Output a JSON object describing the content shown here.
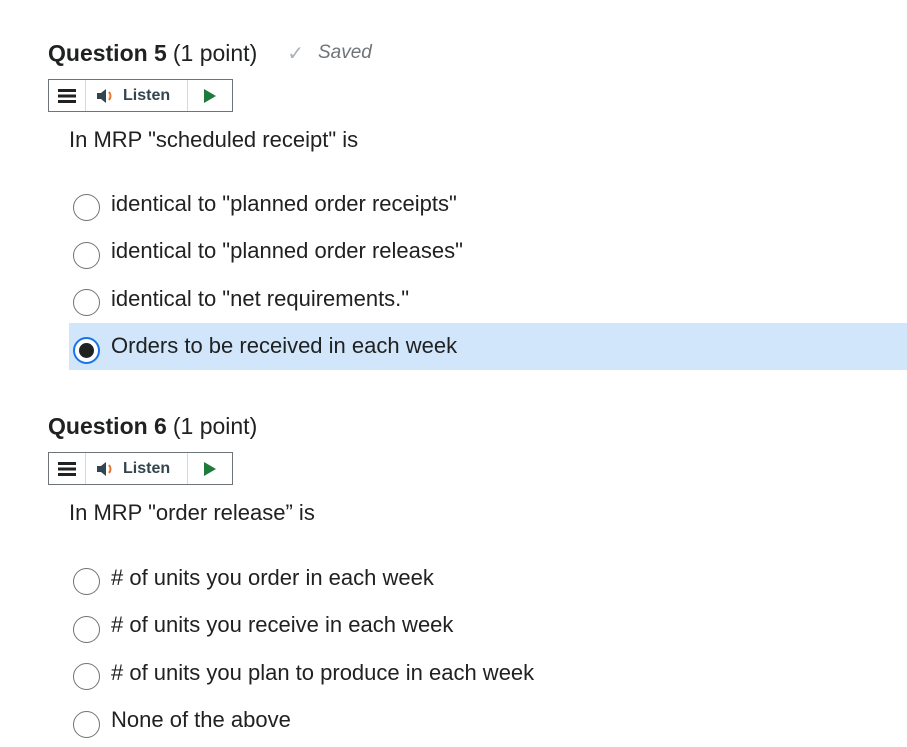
{
  "questions": [
    {
      "label": "Question 5",
      "points": "(1 point)",
      "saved": "Saved",
      "listen": "Listen",
      "text": "In MRP \"scheduled receipt\" is",
      "options": [
        {
          "label": "identical to \"planned order receipts\"",
          "selected": false
        },
        {
          "label": "identical to \"planned order releases\"",
          "selected": false
        },
        {
          "label": "identical to \"net requirements.\"",
          "selected": false
        },
        {
          "label": "Orders to be received in each week",
          "selected": true
        }
      ]
    },
    {
      "label": "Question 6",
      "points": "(1 point)",
      "listen": "Listen",
      "text": "In MRP \"order release” is",
      "options": [
        {
          "label": "# of units you order in each week",
          "selected": false
        },
        {
          "label": "# of units you receive in each week",
          "selected": false
        },
        {
          "label": "# of units you plan to produce in each week",
          "selected": false
        },
        {
          "label": "None of the above",
          "selected": false
        }
      ]
    }
  ],
  "colors": {
    "selected_bg": "#d1e6fb",
    "radio_focus": "#1a73e8",
    "play": "#1f7a3c"
  },
  "icons": {
    "menu": "hamburger-icon",
    "speaker": "speaker-icon",
    "play": "play-icon",
    "saved": "checkmark-icon"
  }
}
